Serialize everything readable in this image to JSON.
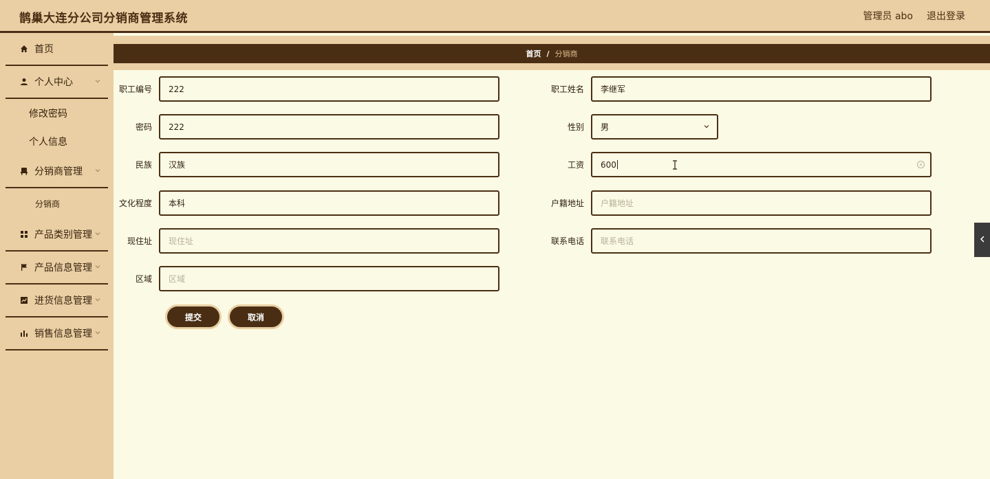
{
  "app": {
    "title": "鹊巢大连分公司分销商管理系统",
    "admin_label": "管理员 abo",
    "logout_label": "退出登录"
  },
  "sidebar": {
    "home": "首页",
    "personal_center": "个人中心",
    "change_password": "修改密码",
    "personal_info": "个人信息",
    "distributor_mgmt": "分销商管理",
    "distributor": "分销商",
    "product_category_mgmt": "产品类别管理",
    "product_info_mgmt": "产品信息管理",
    "purchase_info_mgmt": "进货信息管理",
    "sales_info_mgmt": "销售信息管理"
  },
  "breadcrumb": {
    "home": "首页",
    "separator": "/",
    "current": "分销商"
  },
  "form": {
    "employee_id": {
      "label": "职工编号",
      "value": "222"
    },
    "employee_name": {
      "label": "职工姓名",
      "value": "李继军"
    },
    "password": {
      "label": "密码",
      "value": "222"
    },
    "gender": {
      "label": "性别",
      "value": "男"
    },
    "ethnicity": {
      "label": "民族",
      "value": "汉族"
    },
    "salary": {
      "label": "工资",
      "value": "600"
    },
    "education": {
      "label": "文化程度",
      "value": "本科"
    },
    "household_address": {
      "label": "户籍地址",
      "placeholder": "户籍地址"
    },
    "current_address": {
      "label": "现住址",
      "placeholder": "现住址"
    },
    "phone": {
      "label": "联系电话",
      "placeholder": "联系电话"
    },
    "region": {
      "label": "区域",
      "placeholder": "区域"
    },
    "submit_label": "提交",
    "cancel_label": "取消"
  },
  "colors": {
    "brand_dark": "#4a2e14",
    "brand_light": "#e9cfa3",
    "page_bg": "#fbfae4"
  }
}
